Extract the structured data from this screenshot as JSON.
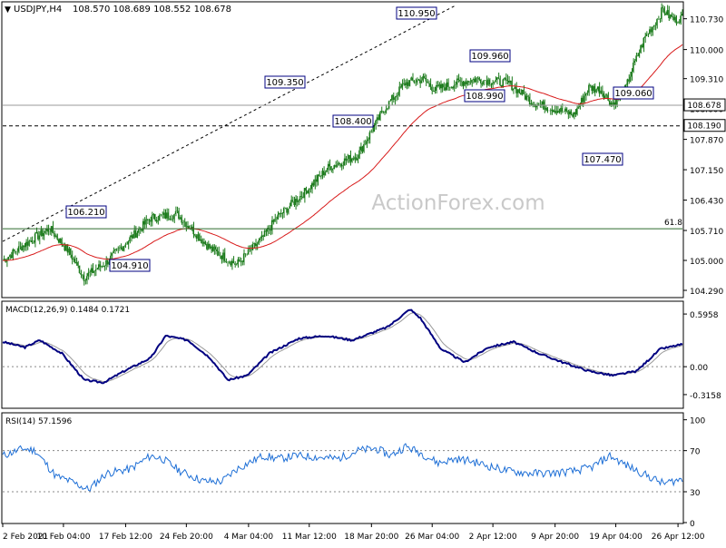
{
  "header": {
    "symbol": "USDJPY,H4",
    "ohlc": "108.570 108.689 108.552 108.678",
    "caret": "▼"
  },
  "watermark": "ActionForex.com",
  "colors": {
    "ema": "#d81b1b",
    "macd": "#000080",
    "signal": "#9a9a9a",
    "rsi": "#1e6fd6",
    "candle": "#1a7a1a",
    "labelBorder": "#000080",
    "trendline": "#000000"
  },
  "chart_data": [
    {
      "type": "line",
      "subtype": "candlestick",
      "title": "USDJPY,H4",
      "price_ticks": [
        "110.730",
        "110.000",
        "109.310",
        "108.600",
        "107.870",
        "107.150",
        "106.430",
        "105.710",
        "105.000",
        "104.290"
      ],
      "price_tick_values": [
        110.73,
        110.0,
        109.31,
        108.6,
        107.87,
        107.15,
        106.43,
        105.71,
        105.0,
        104.29
      ],
      "ylim": [
        104.14,
        111.11
      ],
      "x_labels": [
        "2 Feb 2021",
        "10 Feb 04:00",
        "17 Feb 12:00",
        "24 Feb 20:00",
        "4 Mar 04:00",
        "11 Mar 12:00",
        "18 Mar 20:00",
        "26 Mar 04:00",
        "2 Apr 12:00",
        "9 Apr 20:00",
        "19 Apr 04:00",
        "26 Apr 12:00"
      ],
      "x_label_index": [
        0,
        41,
        83,
        124,
        166,
        207,
        249,
        290,
        331,
        373,
        414,
        456
      ],
      "bar_count": 460,
      "close_anchors": [
        [
          0,
          105.0
        ],
        [
          20,
          105.5
        ],
        [
          32,
          105.75
        ],
        [
          45,
          105.2
        ],
        [
          55,
          104.6
        ],
        [
          70,
          104.95
        ],
        [
          100,
          106.0
        ],
        [
          118,
          106.1
        ],
        [
          140,
          105.3
        ],
        [
          158,
          104.9
        ],
        [
          175,
          105.5
        ],
        [
          185,
          106.0
        ],
        [
          205,
          106.65
        ],
        [
          220,
          107.2
        ],
        [
          240,
          107.5
        ],
        [
          258,
          108.6
        ],
        [
          272,
          109.2
        ],
        [
          284,
          109.3
        ],
        [
          292,
          109.05
        ],
        [
          306,
          109.2
        ],
        [
          320,
          109.3
        ],
        [
          342,
          109.2
        ],
        [
          358,
          108.75
        ],
        [
          372,
          108.6
        ],
        [
          386,
          108.45
        ],
        [
          396,
          109.1
        ],
        [
          404,
          109.05
        ],
        [
          412,
          108.7
        ],
        [
          420,
          109.0
        ],
        [
          426,
          109.6
        ],
        [
          434,
          110.3
        ],
        [
          440,
          110.6
        ],
        [
          446,
          110.95
        ],
        [
          450,
          110.8
        ],
        [
          454,
          110.7
        ]
      ],
      "ema_period": 55,
      "price_labels": [
        {
          "text": "110.950",
          "value": 110.95
        },
        {
          "text": "109.350",
          "value": 109.35
        },
        {
          "text": "109.960",
          "value": 109.96
        },
        {
          "text": "108.990",
          "value": 108.99
        },
        {
          "text": "109.060",
          "value": 109.06
        },
        {
          "text": "108.400",
          "value": 108.4
        },
        {
          "text": "106.210",
          "value": 106.21
        },
        {
          "text": "104.910",
          "value": 104.91
        },
        {
          "text": "107.470",
          "value": 107.47
        }
      ],
      "current_price": "108.678",
      "current_price_value": 108.678,
      "level_108190": "108.190",
      "level_108190_value": 108.19,
      "fib_label": "61.8",
      "fib_value": 105.75
    },
    {
      "type": "line",
      "title": "MACD(12,26,9) 0.1484 0.1721",
      "series": [
        {
          "name": "MACD"
        },
        {
          "name": "Signal"
        }
      ],
      "ticks": [
        "0.5958",
        "0.00",
        "-0.3158"
      ],
      "tick_values": [
        0.5958,
        0.0,
        -0.3158
      ],
      "ylim": [
        -0.45,
        0.72
      ],
      "macd_anchors": [
        [
          0,
          0.28
        ],
        [
          15,
          0.22
        ],
        [
          25,
          0.3
        ],
        [
          40,
          0.15
        ],
        [
          55,
          -0.15
        ],
        [
          68,
          -0.18
        ],
        [
          82,
          -0.05
        ],
        [
          100,
          0.1
        ],
        [
          110,
          0.35
        ],
        [
          125,
          0.3
        ],
        [
          140,
          0.1
        ],
        [
          152,
          -0.15
        ],
        [
          165,
          -0.1
        ],
        [
          180,
          0.15
        ],
        [
          200,
          0.32
        ],
        [
          218,
          0.35
        ],
        [
          236,
          0.3
        ],
        [
          260,
          0.45
        ],
        [
          275,
          0.65
        ],
        [
          282,
          0.55
        ],
        [
          296,
          0.2
        ],
        [
          312,
          0.05
        ],
        [
          328,
          0.22
        ],
        [
          345,
          0.28
        ],
        [
          362,
          0.15
        ],
        [
          378,
          0.05
        ],
        [
          396,
          -0.05
        ],
        [
          412,
          -0.1
        ],
        [
          428,
          -0.05
        ],
        [
          444,
          0.2
        ],
        [
          458,
          0.25
        ]
      ],
      "macd_label": "MACD(12,26,9) 0.1484 0.1721"
    },
    {
      "type": "line",
      "title": "RSI(14) 57.1596",
      "series": [
        {
          "name": "RSI(14)"
        }
      ],
      "ticks": [
        "100",
        "70",
        "30",
        "0"
      ],
      "tick_values": [
        100,
        70,
        30,
        0
      ],
      "ylim": [
        0,
        105
      ],
      "rsi_anchors": [
        [
          0,
          65
        ],
        [
          14,
          72
        ],
        [
          22,
          70
        ],
        [
          36,
          45
        ],
        [
          46,
          40
        ],
        [
          58,
          32
        ],
        [
          70,
          48
        ],
        [
          86,
          52
        ],
        [
          100,
          65
        ],
        [
          108,
          62
        ],
        [
          120,
          50
        ],
        [
          136,
          40
        ],
        [
          148,
          40
        ],
        [
          158,
          52
        ],
        [
          166,
          58
        ],
        [
          176,
          65
        ],
        [
          186,
          62
        ],
        [
          198,
          65
        ],
        [
          210,
          64
        ],
        [
          226,
          62
        ],
        [
          240,
          70
        ],
        [
          252,
          72
        ],
        [
          262,
          65
        ],
        [
          272,
          74
        ],
        [
          282,
          68
        ],
        [
          294,
          58
        ],
        [
          306,
          62
        ],
        [
          316,
          60
        ],
        [
          328,
          55
        ],
        [
          342,
          50
        ],
        [
          356,
          48
        ],
        [
          370,
          48
        ],
        [
          386,
          50
        ],
        [
          398,
          54
        ],
        [
          410,
          65
        ],
        [
          422,
          55
        ],
        [
          436,
          45
        ],
        [
          446,
          38
        ],
        [
          458,
          42
        ]
      ],
      "rsi_label": "RSI(14) 57.1596"
    }
  ]
}
